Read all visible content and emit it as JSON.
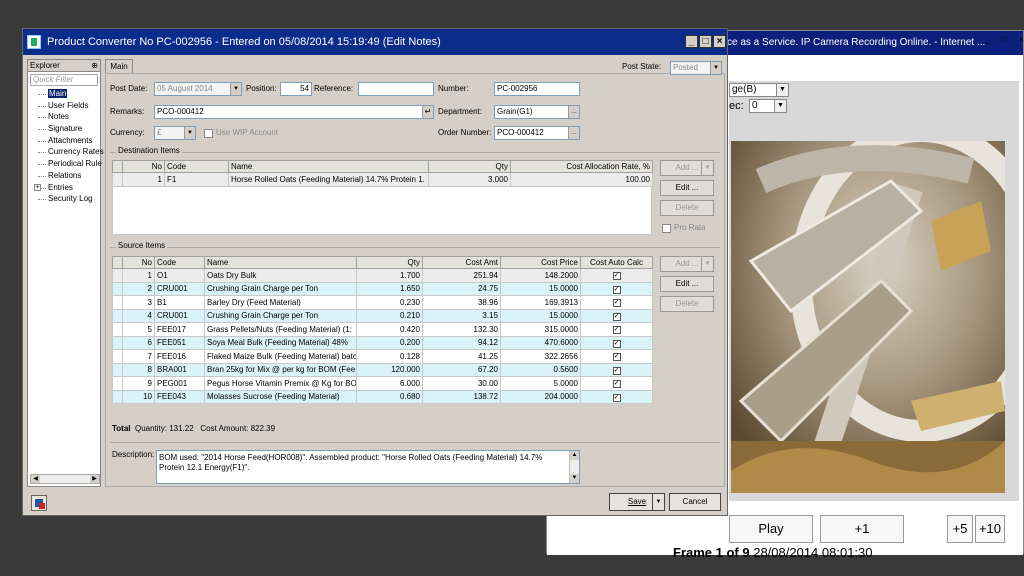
{
  "ie": {
    "title": "ce as a Service. IP Camera Recording Online. - Internet ...",
    "select1": "ge(B)",
    "label2": "ec:",
    "select2": "0",
    "play": "Play",
    "plus1": "+1",
    "plus5": "+5",
    "plus10": "+10",
    "frame_bold": "Frame 1 of 9",
    "frame_time": "28/08/2014 08:01:30"
  },
  "app": {
    "title": "Product Converter No PC-002956 - Entered on 05/08/2014 15:19:49 (Edit Notes)",
    "tab": "Main",
    "post_state_label": "Post State:",
    "post_state": "Posted",
    "post_date_label": "Post Date:",
    "post_date": "05  August  2014",
    "position_label": "Position:",
    "position": "54",
    "reference_label": "Reference:",
    "reference": "",
    "number_label": "Number:",
    "number": "PC-002956",
    "remarks_label": "Remarks:",
    "remarks": "PCO-000412",
    "department_label": "Department:",
    "department": "Grain(G1)",
    "currency_label": "Currency:",
    "currency": "£",
    "use_wip_label": "Use WIP Account",
    "order_number_label": "Order Number:",
    "order_number": "PCO-000412",
    "dest_group": "Destination Items",
    "source_group": "Source Items",
    "total_label": "Total",
    "total_quantity": "Quantity: 131.22",
    "total_amount": "Cost Amount: 822.39",
    "description_label": "Description:",
    "description": "BOM used: \"2014 Horse Feed(HOR008)\". Assembled product: \"Horse Rolled Oats (Feeding Material)  14.7% Protein  12.1 Energy(F1)\".",
    "save": "Save",
    "cancel": "Cancel"
  },
  "explorer": {
    "title": "Explorer",
    "pin": "⊕",
    "filter_placeholder": "Quick Filter",
    "items": [
      "Main",
      "User Fields",
      "Notes",
      "Signature",
      "Attachments",
      "Currency Rates",
      "Periodical Rule",
      "Relations",
      "Entries",
      "Security Log"
    ]
  },
  "dest": {
    "headers": [
      "No",
      "Code",
      "Name",
      "Qty",
      "Cost Allocation Rate, %"
    ],
    "rows": [
      [
        "1",
        "F1",
        "Horse Rolled Oats (Feeding Material)  14.7% Protein  1.",
        "3.000",
        "100.00"
      ]
    ],
    "buttons": {
      "add": "Add ...",
      "edit": "Edit ...",
      "delete": "Delete",
      "pro_rata": "Pro Rata"
    }
  },
  "source": {
    "headers": [
      "No",
      "Code",
      "Name",
      "Qty",
      "Cost Amt",
      "Cost Price",
      "Cost Auto Calc"
    ],
    "rows": [
      [
        "1",
        "O1",
        "Oats Dry Bulk",
        "1.700",
        "251.94",
        "148.2000"
      ],
      [
        "2",
        "CRU001",
        "Crushing Grain Charge per Ton",
        "1.650",
        "24.75",
        "15.0000"
      ],
      [
        "3",
        "B1",
        "Barley Dry (Feed Material)",
        "0.230",
        "38.96",
        "169.3913"
      ],
      [
        "4",
        "CRU001",
        "Crushing Grain Charge per Ton",
        "0.210",
        "3.15",
        "15.0000"
      ],
      [
        "5",
        "FEE017",
        "Grass Pellets/Nuts  (Feeding Material)  (1:",
        "0.420",
        "132.30",
        "315.0000"
      ],
      [
        "6",
        "FEE051",
        "Soya Meal Bulk   (Feeding Material)   48%",
        "0.200",
        "94.12",
        "470.6000"
      ],
      [
        "7",
        "FEE016",
        "Flaked Maize Bulk  (Feeding Material) batch",
        "0.128",
        "41.25",
        "322.2656"
      ],
      [
        "8",
        "BRA001",
        "Bran 25kg  for Mix @ per kg for BOM  (Fee",
        "120.000",
        "67.20",
        "0.5600"
      ],
      [
        "9",
        "PEG001",
        "Pegus Horse  Vitamin Premix @ Kg for BOM",
        "6.000",
        "30.00",
        "5.0000"
      ],
      [
        "10",
        "FEE043",
        "Molasses Sucrose  (Feeding Material)",
        "0.680",
        "138.72",
        "204.0000"
      ]
    ],
    "buttons": {
      "add": "Add ...",
      "edit": "Edit ...",
      "delete": "Delete"
    }
  }
}
